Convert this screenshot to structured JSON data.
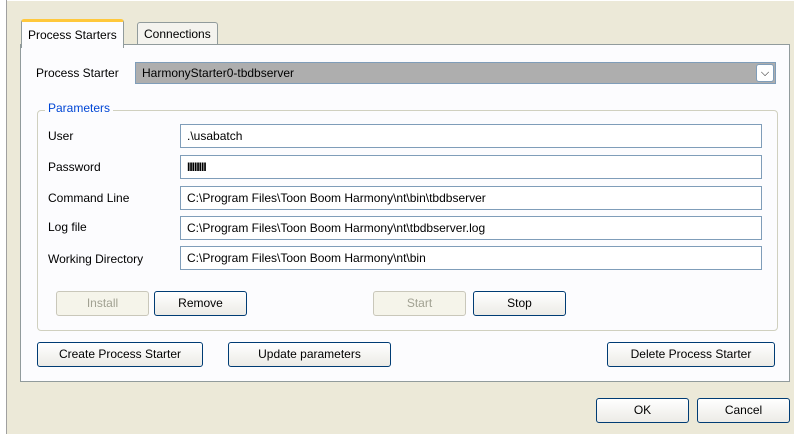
{
  "tabs": [
    {
      "label": "Process Starters",
      "active": true
    },
    {
      "label": "Connections",
      "active": false
    }
  ],
  "process_starter": {
    "label": "Process Starter",
    "value": "HarmonyStarter0-tbdbserver"
  },
  "parameters": {
    "title": "Parameters",
    "fields": [
      {
        "label": "User",
        "value": ".\\usabatch"
      },
      {
        "label": "Password",
        "value": "IIIIIIII"
      },
      {
        "label": "Command Line",
        "value": "C:\\Program Files\\Toon Boom Harmony\\nt\\bin\\tbdbserver"
      },
      {
        "label": "Log file",
        "value": "C:\\Program Files\\Toon Boom Harmony\\nt\\tbdbserver.log"
      },
      {
        "label": "Working Directory",
        "value": "C:\\Program Files\\Toon Boom Harmony\\nt\\bin"
      }
    ]
  },
  "service_buttons": {
    "install": "Install",
    "remove": "Remove",
    "start": "Start",
    "stop": "Stop"
  },
  "action_buttons": {
    "create": "Create Process Starter",
    "update": "Update parameters",
    "delete": "Delete Process Starter"
  },
  "dialog_buttons": {
    "ok": "OK",
    "cancel": "Cancel"
  },
  "icons": {
    "dropdown": "chevron-down-icon"
  }
}
